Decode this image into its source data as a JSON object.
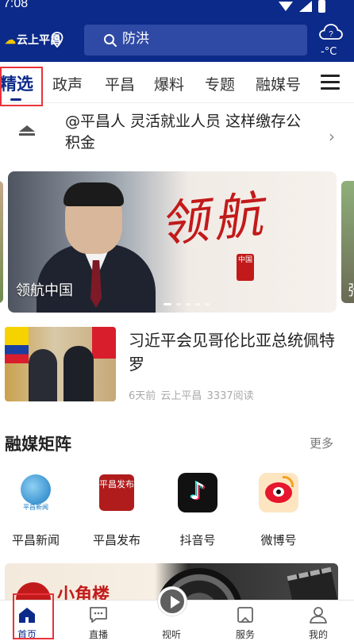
{
  "status_bar": {
    "time": "7:08"
  },
  "header": {
    "logo_text": "云上平昌",
    "search_placeholder": "防洪",
    "weather_temp": "-°C"
  },
  "tabs": [
    {
      "label": "精选",
      "active": true
    },
    {
      "label": "政声"
    },
    {
      "label": "平昌"
    },
    {
      "label": "爆料"
    },
    {
      "label": "专题"
    },
    {
      "label": "融媒号"
    }
  ],
  "notice": {
    "text": "@平昌人 灵活就业人员 这样缴存公积金"
  },
  "carousel": {
    "caption": "领航中国",
    "calligraphy": "领航",
    "seal_text": "中国",
    "next_slide_fragment": "张",
    "dot_count": 5,
    "active_dot": 0
  },
  "news_item": {
    "title": "习近平会见哥伦比亚总统佩特罗",
    "time": "6天前",
    "source": "云上平昌",
    "reads": "3337阅读"
  },
  "matrix": {
    "title": "融媒矩阵",
    "more_label": "更多",
    "items": [
      {
        "label": "平昌新闻",
        "icon": "pingchang-news-icon",
        "icon_tag": "平昌新闻"
      },
      {
        "label": "平昌发布",
        "icon": "pingchang-release-icon",
        "icon_tag": "平昌发布"
      },
      {
        "label": "抖音号",
        "icon": "douyin-icon"
      },
      {
        "label": "微博号",
        "icon": "weibo-icon"
      }
    ]
  },
  "banner": {
    "text": "小角楼"
  },
  "bottom_nav": [
    {
      "label": "首页",
      "icon": "home-icon",
      "active": true
    },
    {
      "label": "直播",
      "icon": "live-icon"
    },
    {
      "label": "视听",
      "icon": "play-icon"
    },
    {
      "label": "服务",
      "icon": "service-icon"
    },
    {
      "label": "我的",
      "icon": "profile-icon"
    }
  ],
  "colors": {
    "brand_blue": "#0b2a8a",
    "highlight_red": "#e8333b"
  }
}
